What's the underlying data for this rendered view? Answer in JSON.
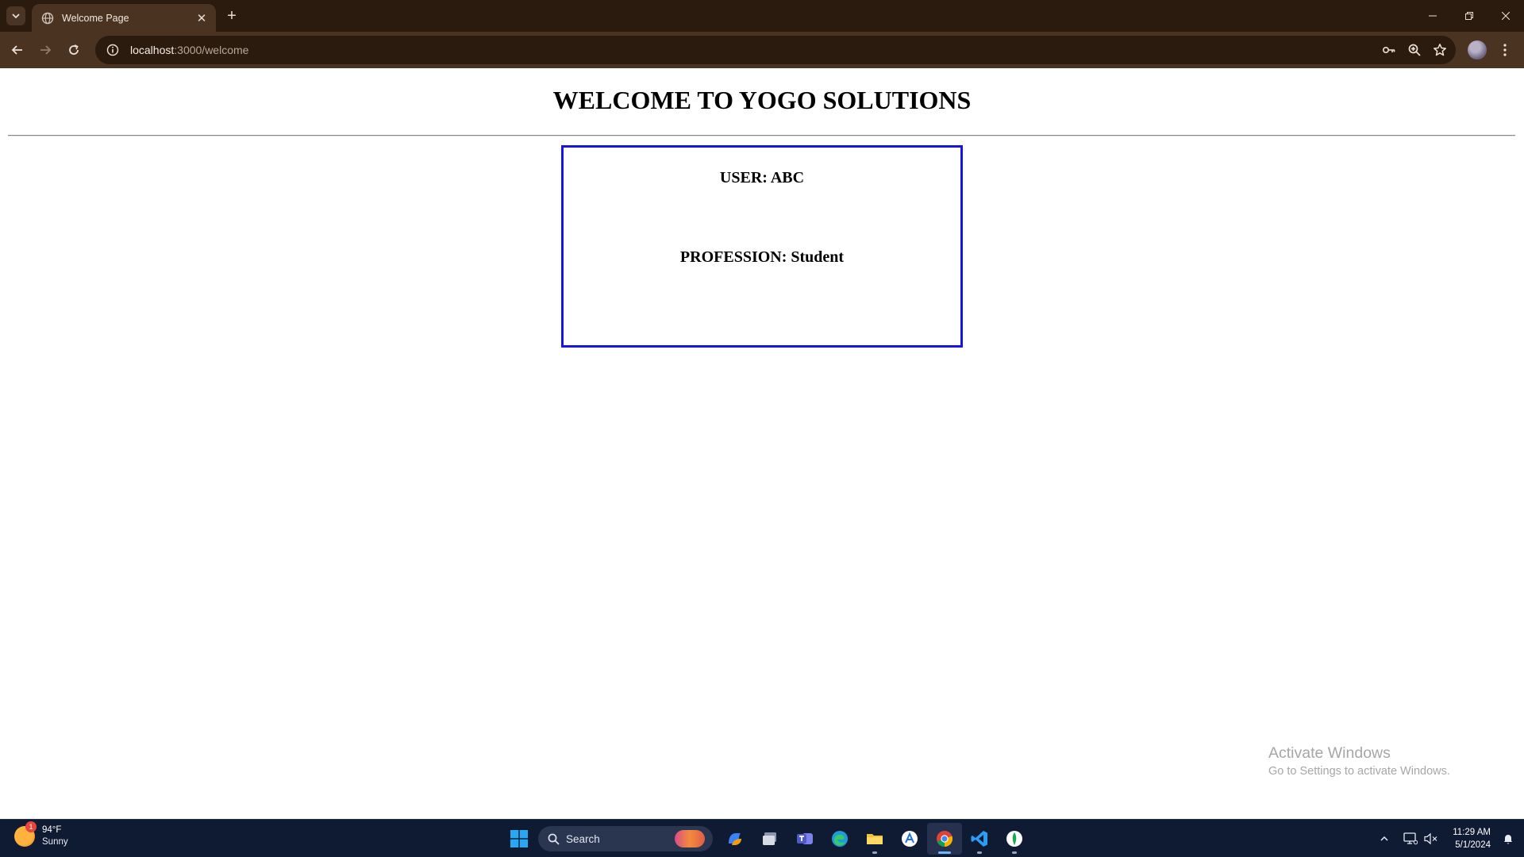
{
  "browser": {
    "tab": {
      "title": "Welcome Page",
      "close_glyph": "✕"
    },
    "new_tab_glyph": "+",
    "address": {
      "host": "localhost",
      "path": ":3000/welcome"
    }
  },
  "page": {
    "heading": "WELCOME TO YOGO SOLUTIONS",
    "user_line": "USER: ABC",
    "profession_line": "PROFESSION: Student",
    "card_border_color": "#1515e6"
  },
  "watermark": {
    "title": "Activate Windows",
    "subtitle": "Go to Settings to activate Windows."
  },
  "taskbar": {
    "weather": {
      "temp": "94°F",
      "condition": "Sunny",
      "badge": "1"
    },
    "search_label": "Search",
    "apps": [
      "copilot-icon",
      "task-view-icon",
      "teams-icon",
      "edge-icon",
      "file-explorer-icon",
      "app-icon",
      "chrome-icon",
      "vscode-icon",
      "mongodb-compass-icon"
    ],
    "clock": {
      "time": "11:29 AM",
      "date": "5/1/2024"
    }
  }
}
